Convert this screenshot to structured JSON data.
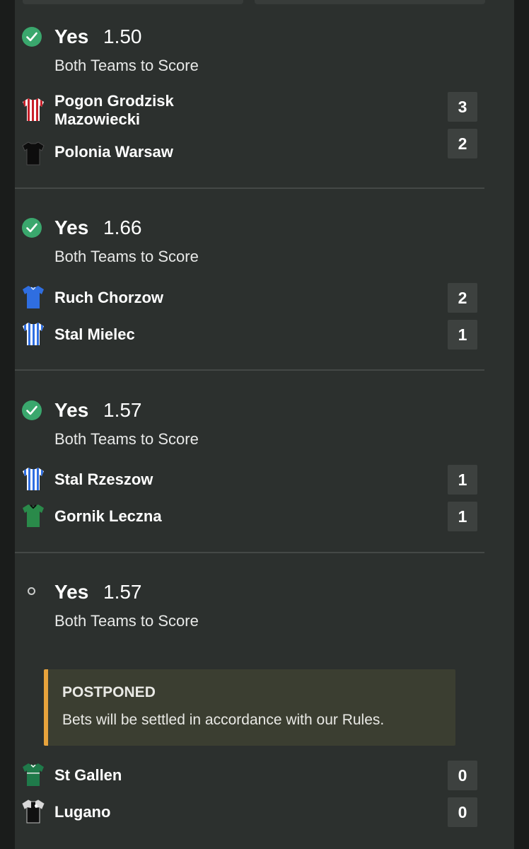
{
  "colors": {
    "background": "#1a1c1b",
    "panel": "#2c302e",
    "won": "#3aa76d",
    "notice_accent": "#e8a33c",
    "score_box": "#3d413f"
  },
  "bets": [
    {
      "status": "won",
      "selection": "Yes",
      "odds": "1.50",
      "market": "Both Teams to Score",
      "teams": [
        {
          "name": "Pogon Grodzisk Mazowiecki",
          "score": "3",
          "shirt": "red-white-stripes-shirt-icon"
        },
        {
          "name": "Polonia Warsaw",
          "score": "2",
          "shirt": "black-shirt-icon"
        }
      ]
    },
    {
      "status": "won",
      "selection": "Yes",
      "odds": "1.66",
      "market": "Both Teams to Score",
      "teams": [
        {
          "name": "Ruch Chorzow",
          "score": "2",
          "shirt": "blue-shirt-icon"
        },
        {
          "name": "Stal Mielec",
          "score": "1",
          "shirt": "blue-white-stripes-shirt-icon"
        }
      ]
    },
    {
      "status": "won",
      "selection": "Yes",
      "odds": "1.57",
      "market": "Both Teams to Score",
      "teams": [
        {
          "name": "Stal Rzeszow",
          "score": "1",
          "shirt": "blue-white-stripes-shirt-icon"
        },
        {
          "name": "Gornik Leczna",
          "score": "1",
          "shirt": "green-shirt-icon"
        }
      ]
    },
    {
      "status": "pending",
      "selection": "Yes",
      "odds": "1.57",
      "market": "Both Teams to Score",
      "notice": {
        "title": "POSTPONED",
        "text": "Bets will be settled in accordance with our Rules."
      },
      "teams": [
        {
          "name": "St Gallen",
          "score": "0",
          "shirt": "green-white-shirt-icon"
        },
        {
          "name": "Lugano",
          "score": "0",
          "shirt": "black-white-shirt-icon"
        }
      ]
    }
  ]
}
